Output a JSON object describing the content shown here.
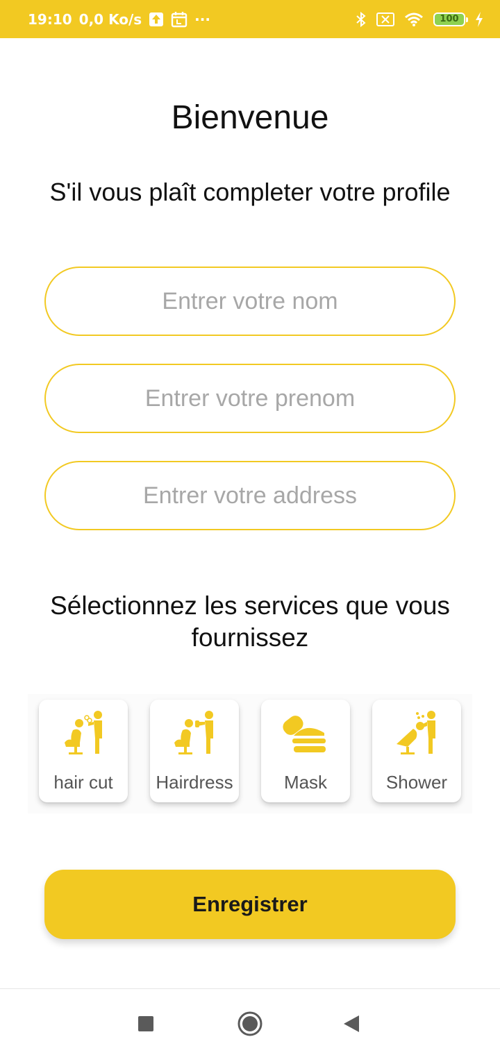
{
  "status_bar": {
    "time": "19:10",
    "speed": "0,0 Ko/s",
    "dots": "···",
    "battery": "100",
    "icons": [
      "upload-icon",
      "calendar-icon",
      "bluetooth-icon",
      "sim-x-icon",
      "wifi-icon",
      "battery-icon",
      "charging-icon"
    ]
  },
  "title": "Bienvenue",
  "subtitle": "S'il vous plaît completer votre profile",
  "form": {
    "nom_placeholder": "Entrer votre nom",
    "prenom_placeholder": "Entrer votre prenom",
    "address_placeholder": "Entrer votre address"
  },
  "services_title": "Sélectionnez les services que vous fournissez",
  "services": [
    {
      "label": "hair cut",
      "icon": "haircut-icon"
    },
    {
      "label": "Hairdress",
      "icon": "hairdress-icon"
    },
    {
      "label": "Mask",
      "icon": "mask-icon"
    },
    {
      "label": "Shower",
      "icon": "shower-icon"
    }
  ],
  "submit_label": "Enregistrer",
  "colors": {
    "accent": "#f2c922",
    "placeholder": "#a7a7a7",
    "text": "#111111"
  },
  "nav": {
    "icons": [
      "recents-icon",
      "home-icon",
      "back-icon"
    ]
  }
}
